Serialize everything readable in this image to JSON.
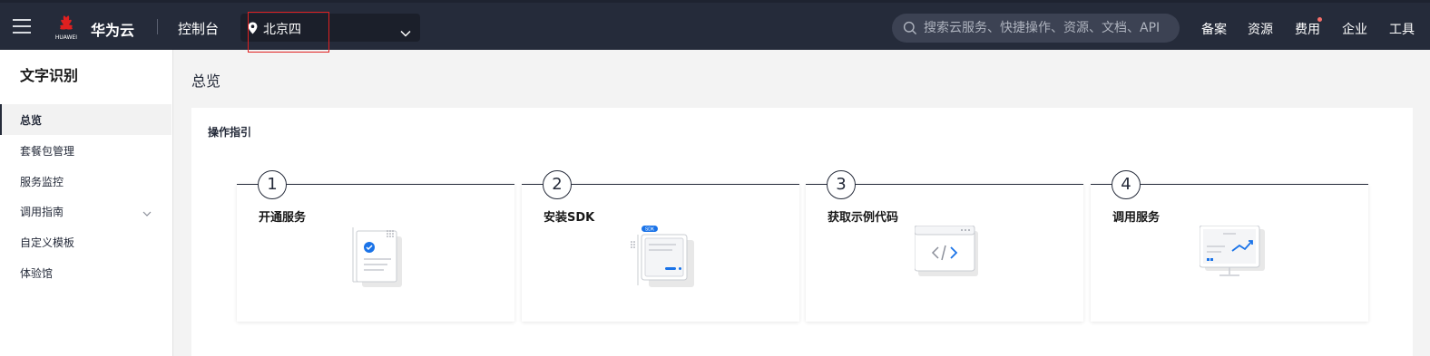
{
  "topbar": {
    "logo_text": "HUAWEI",
    "brand": "华为云",
    "console": "控制台",
    "region": "北京四",
    "search_placeholder": "搜索云服务、快捷操作、资源、文档、API",
    "nav": [
      "备案",
      "资源",
      "费用",
      "企业",
      "工具"
    ]
  },
  "sidebar": {
    "title": "文字识别",
    "items": [
      {
        "label": "总览"
      },
      {
        "label": "套餐包管理"
      },
      {
        "label": "服务监控"
      },
      {
        "label": "调用指南"
      },
      {
        "label": "自定义模板"
      },
      {
        "label": "体验馆"
      }
    ]
  },
  "main": {
    "page_title": "总览",
    "panel_title": "操作指引",
    "steps": [
      {
        "num": "1",
        "title": "开通服务",
        "icon": "document-check-icon"
      },
      {
        "num": "2",
        "title": "安装SDK",
        "icon": "sdk-package-icon"
      },
      {
        "num": "3",
        "title": "获取示例代码",
        "icon": "code-window-icon"
      },
      {
        "num": "4",
        "title": "调用服务",
        "icon": "monitor-chart-icon"
      }
    ]
  },
  "colors": {
    "topbar_bg": "#252b3a",
    "accent_blue": "#1a73e8",
    "highlight_red": "#e02020"
  }
}
